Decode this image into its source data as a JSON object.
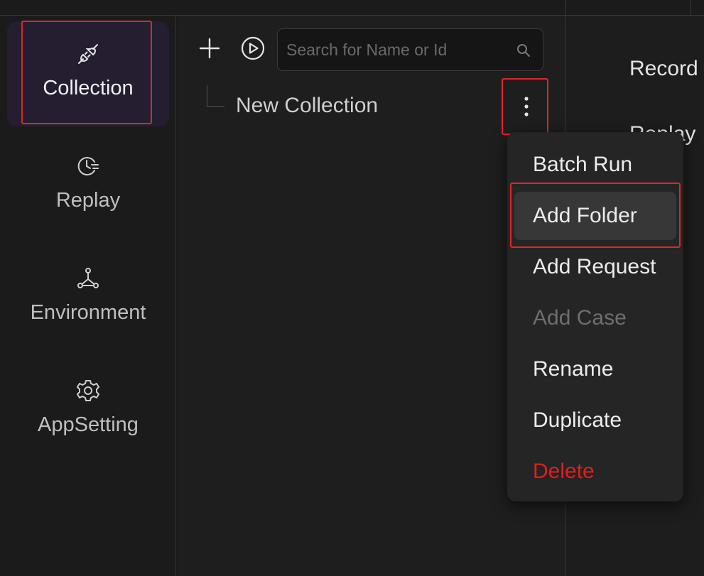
{
  "nav": {
    "items": [
      {
        "label": "Collection",
        "icon": "plug-icon",
        "active": true
      },
      {
        "label": "Replay",
        "icon": "clock-list-icon"
      },
      {
        "label": "Environment",
        "icon": "network-icon"
      },
      {
        "label": "AppSetting",
        "icon": "gear-icon"
      }
    ]
  },
  "collection_panel": {
    "search_placeholder": "Search for Name or Id",
    "tree": [
      {
        "label": "New Collection"
      }
    ]
  },
  "context_menu": {
    "items": [
      {
        "label": "Batch Run"
      },
      {
        "label": "Add Folder",
        "state": "hovered"
      },
      {
        "label": "Add Request"
      },
      {
        "label": "Add Case",
        "state": "disabled"
      },
      {
        "label": "Rename"
      },
      {
        "label": "Duplicate"
      },
      {
        "label": "Delete",
        "state": "danger"
      }
    ]
  },
  "right_panel": {
    "items": [
      "Record",
      "Replay"
    ]
  },
  "colors": {
    "highlight_box": "#e0262a",
    "active_nav_bg": "#241e30",
    "danger": "#e01e1e"
  }
}
